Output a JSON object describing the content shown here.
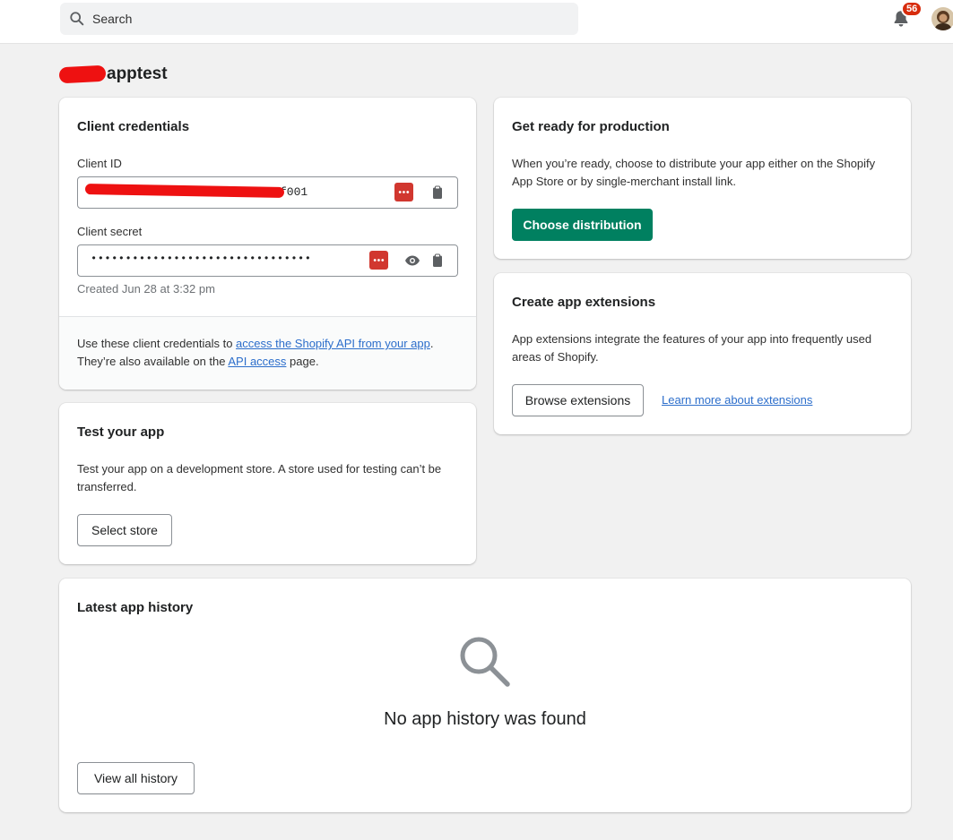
{
  "colors": {
    "primary_button": "#008060",
    "link": "#2c6ecb",
    "badge": "#d72c0d",
    "redaction": "#ee1111",
    "password_manager": "#d1372f"
  },
  "topbar": {
    "search_placeholder": "Search",
    "notification_count": "56"
  },
  "page": {
    "title": "apptest"
  },
  "client_credentials": {
    "title": "Client credentials",
    "client_id_label": "Client ID",
    "client_id_value": "f001",
    "client_secret_label": "Client secret",
    "client_secret_value": "••••••••••••••••••••••••••••••••",
    "created": "Created Jun 28 at 3:32 pm",
    "footer_prefix": "Use these client credentials to ",
    "footer_link1": "access the Shopify API from your app",
    "footer_mid": ". They’re also available on the ",
    "footer_link2": "API access",
    "footer_suffix": " page."
  },
  "test_app": {
    "title": "Test your app",
    "description": "Test your app on a development store. A store used for testing can’t be transferred.",
    "button": "Select store"
  },
  "production": {
    "title": "Get ready for production",
    "description": "When you’re ready, choose to distribute your app either on the Shopify App Store or by single-merchant install link.",
    "button": "Choose distribution"
  },
  "extensions": {
    "title": "Create app extensions",
    "description": "App extensions integrate the features of your app into frequently used areas of Shopify.",
    "button": "Browse extensions",
    "link": "Learn more about extensions"
  },
  "history": {
    "title": "Latest app history",
    "empty_icon": "search-icon",
    "empty_message": "No app history was found",
    "button": "View all history"
  }
}
